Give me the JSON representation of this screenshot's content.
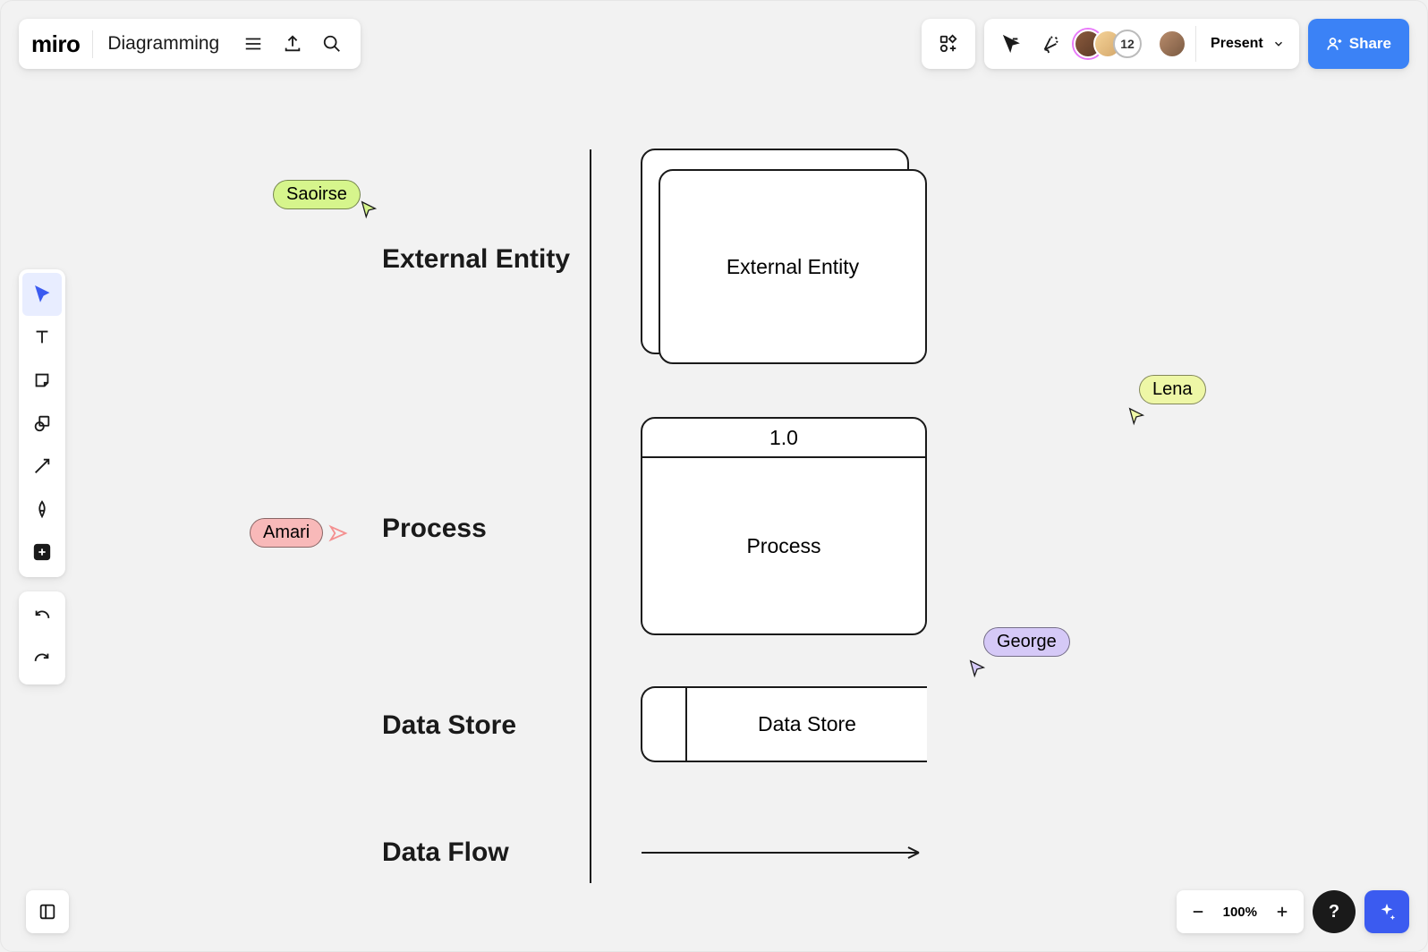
{
  "app": {
    "logo": "miro",
    "board_name": "Diagramming"
  },
  "topbar_left_icons": [
    "menu",
    "export",
    "search"
  ],
  "topbar_right": {
    "apps_icon": "apps",
    "cursor_icon": "cursor-arrow",
    "confetti_icon": "reactions",
    "avatar_overflow": "12",
    "present_label": "Present",
    "share_label": "Share"
  },
  "side_tools": [
    "select",
    "text",
    "sticky",
    "shapes",
    "connector",
    "pen",
    "add"
  ],
  "history": [
    "undo",
    "redo"
  ],
  "bottom_left_icon": "frames",
  "zoom": {
    "level": "100%"
  },
  "bottom_right": {
    "help": "?",
    "ai": "ai-sparkle"
  },
  "diagram": {
    "rows": {
      "external_entity": {
        "label": "External Entity",
        "shape_label": "External Entity"
      },
      "process": {
        "label": "Process",
        "shape_head": "1.0",
        "shape_body": "Process"
      },
      "data_store": {
        "label": "Data Store",
        "shape_label": "Data Store"
      },
      "data_flow": {
        "label": "Data Flow"
      }
    },
    "cursors": {
      "saoirse": {
        "name": "Saoirse",
        "color": "#d6f58c"
      },
      "amari": {
        "name": "Amari",
        "color": "#f8b9b9"
      },
      "lena": {
        "name": "Lena",
        "color": "#eef7a6"
      },
      "george": {
        "name": "George",
        "color": "#d5c9f7"
      }
    }
  }
}
